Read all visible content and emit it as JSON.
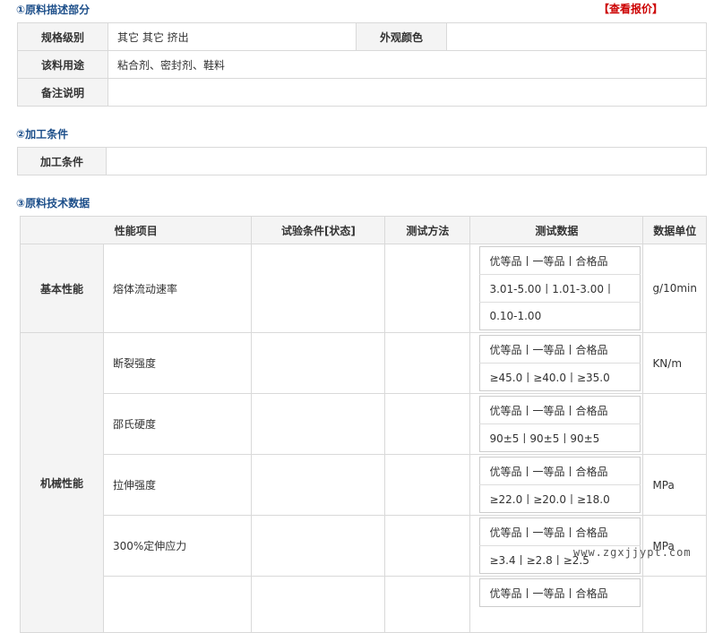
{
  "section1": {
    "title": "①原料描述部分",
    "quote_link": "【查看报价】",
    "rows": {
      "spec_label": "规格级别",
      "spec_value": "其它 其它 挤出",
      "color_label": "外观颜色",
      "color_value": "",
      "use_label": "该料用途",
      "use_value": "粘合剂、密封剂、鞋料",
      "note_label": "备注说明",
      "note_value": ""
    }
  },
  "section2": {
    "title": "②加工条件",
    "label": "加工条件",
    "value": ""
  },
  "section3": {
    "title": "③原料技术数据",
    "headers": {
      "item": "性能项目",
      "condition": "试验条件[状态]",
      "method": "测试方法",
      "data": "测试数据",
      "unit": "数据单位"
    },
    "groups": {
      "basic": "基本性能",
      "mechanical": "机械性能"
    },
    "rows": [
      {
        "name": "熔体流动速率",
        "line1": "优等品丨一等品丨合格品",
        "line2": "3.01-5.00丨1.01-3.00丨",
        "line3": "0.10-1.00",
        "unit": "g/10min"
      },
      {
        "name": "断裂强度",
        "line1": "优等品丨一等品丨合格品",
        "line2": "≥45.0丨≥40.0丨≥35.0",
        "unit": "KN/m"
      },
      {
        "name": "邵氏硬度",
        "line1": "优等品丨一等品丨合格品",
        "line2": "90±5丨90±5丨90±5",
        "unit": ""
      },
      {
        "name": "拉伸强度",
        "line1": "优等品丨一等品丨合格品",
        "line2": "≥22.0丨≥20.0丨≥18.0",
        "unit": "MPa"
      },
      {
        "name": "300%定伸应力",
        "line1": "优等品丨一等品丨合格品",
        "line2": "≥3.4丨≥2.8丨≥2.5",
        "unit": "MPa"
      },
      {
        "name": "",
        "line1": "优等品丨一等品丨合格品",
        "unit": ""
      }
    ]
  },
  "watermark": "www.zgxjjypt.com"
}
